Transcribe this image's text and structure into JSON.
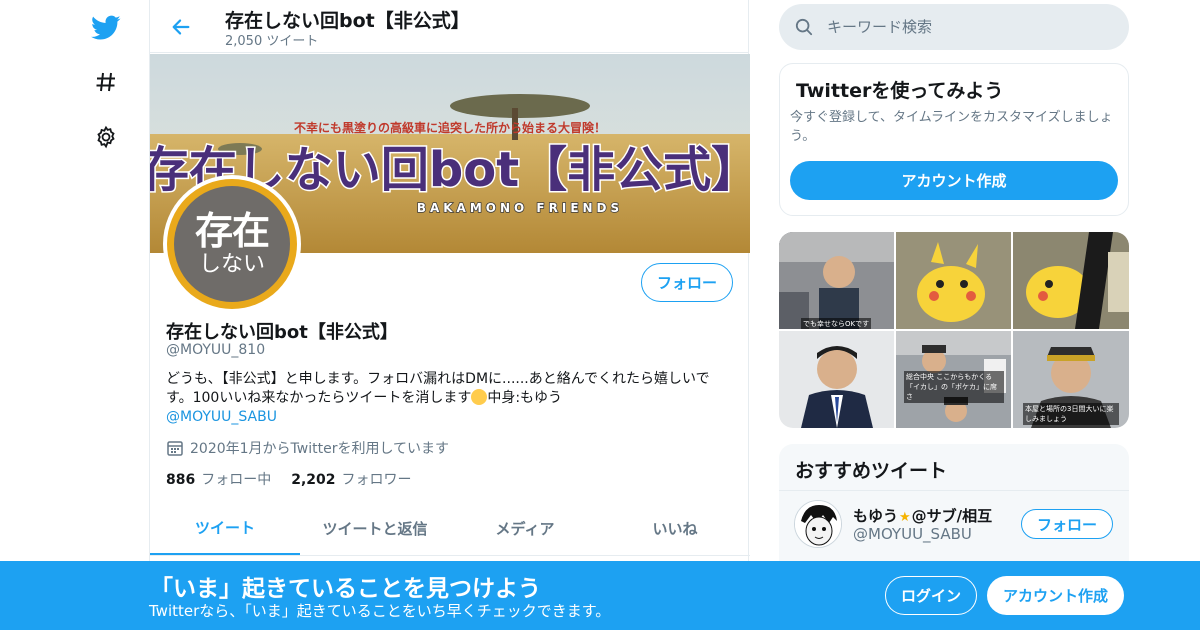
{
  "colors": {
    "accent": "#1da1f2",
    "secondary_text": "#657786",
    "border": "#e6ecf0",
    "bottom_bar": "#1da1f2"
  },
  "left_nav": {
    "items": [
      {
        "icon": "twitter-bird-icon"
      },
      {
        "icon": "hashtag-icon"
      },
      {
        "icon": "gear-icon"
      }
    ]
  },
  "header": {
    "name": "存在しない回bot【非公式】",
    "tweet_count": "2,050 ツイート"
  },
  "banner": {
    "tagline": "不幸にも黒塗りの高級車に追突した所から始まる大冒険！",
    "title": "存在しない回bot【非公式】",
    "subtitle": "BAKAMONO   FRIENDS"
  },
  "avatar": {
    "line1": "存在",
    "line2": "しない"
  },
  "profile": {
    "follow_label": "フォロー",
    "name": "存在しない回bot【非公式】",
    "handle": "@MOYUU_810",
    "bio_text": "どうも、【非公式】と申します。フォロバ漏れはDMに......あと絡んでくれたら嬉しいです。100いいね来なかったらツイートを消します",
    "bio_suffix": "中身:もゆう",
    "bio_link": "@MOYUU_SABU",
    "joined": "2020年1月からTwitterを利用しています",
    "following_count": "886",
    "following_label": "フォロー中",
    "followers_count": "2,202",
    "followers_label": "フォロワー"
  },
  "tabs": [
    {
      "label": "ツイート",
      "active": true
    },
    {
      "label": "ツイートと返信",
      "active": false
    },
    {
      "label": "メディア",
      "active": false
    },
    {
      "label": "いいね",
      "active": false
    }
  ],
  "search": {
    "placeholder": "キーワード検索"
  },
  "try_card": {
    "title": "Twitterを使ってみよう",
    "description": "今すぐ登録して、タイムラインをカスタマイズしましょう。",
    "button": "アカウント作成"
  },
  "media": {
    "captions": [
      "でも幸せならOKです",
      "総合中央 ここからもかくる「イカし」の「ポケカ」に席さ",
      "本屋と場所の3日間大いに楽しみましょう"
    ]
  },
  "recommended": {
    "title": "おすすめツイート",
    "user_name": "もゆう",
    "user_name_suffix": "@サブ/相互",
    "user_handle": "@MOYUU_SABU",
    "follow_label": "フォロー"
  },
  "bottom_bar": {
    "title": "「いま」起きていることを見つけよう",
    "subtitle": "Twitterなら、「いま」起きていることをいち早くチェックできます。",
    "login": "ログイン",
    "signup": "アカウント作成"
  }
}
